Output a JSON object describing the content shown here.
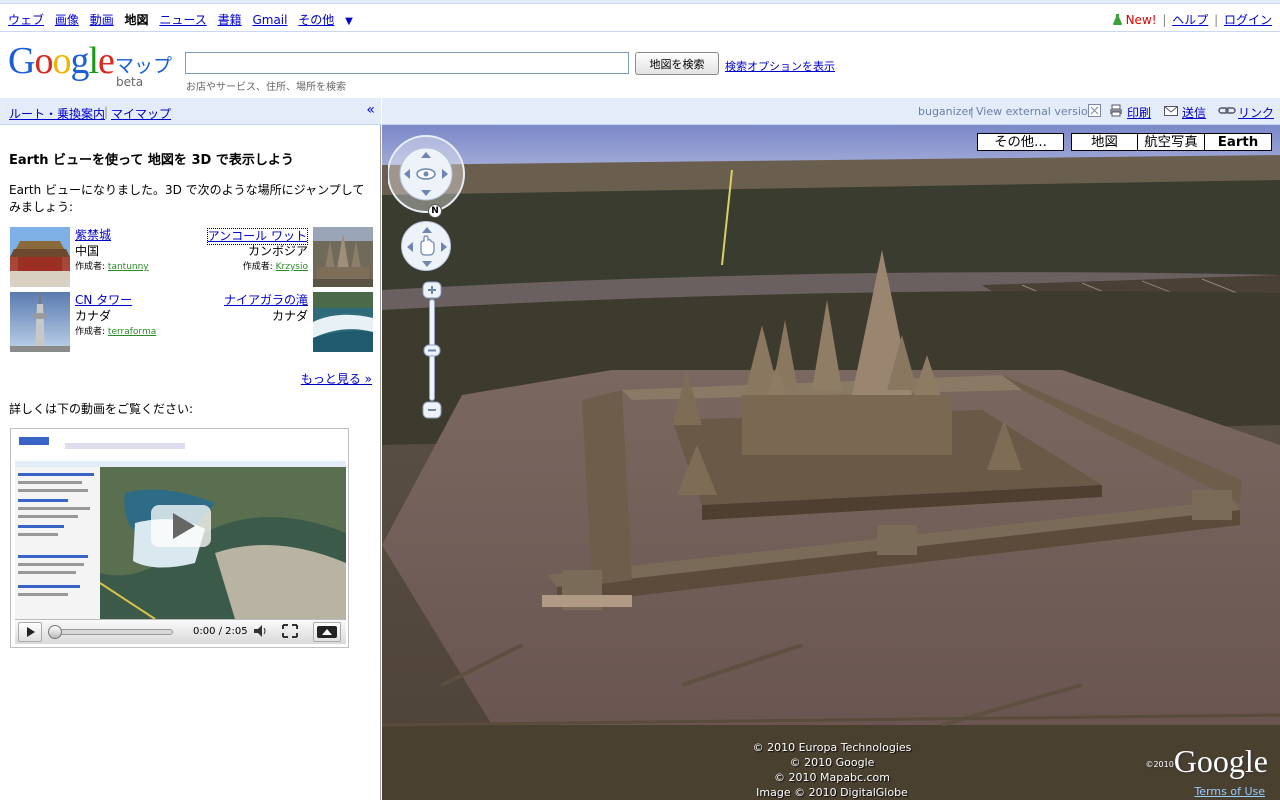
{
  "topnav": {
    "left_links": [
      "ウェブ",
      "画像",
      "動画",
      "地図",
      "ニュース",
      "書籍",
      "Gmail",
      "その他"
    ],
    "current": "地図",
    "more_arrow": "▼",
    "new_label": "New!",
    "sep": "|",
    "help": "ヘルプ",
    "login": "ログイン"
  },
  "header": {
    "logo_letters": [
      "G",
      "o",
      "o",
      "g",
      "l",
      "e"
    ],
    "maps_label": "マップ",
    "beta_label": "beta",
    "search_value": "",
    "search_hint": "お店やサービス、住所、場所を検索",
    "search_button": "地図を検索",
    "search_options": "検索オプションを表示"
  },
  "panel": {
    "route_link": "ルート・乗換案内",
    "sep": "|",
    "mymaps_link": "マイマップ",
    "collapse": "«",
    "title": "Earth ビューを使って 地図を 3D で表示しよう",
    "intro": "Earth ビューになりました。3D で次のような場所にジャンプしてみましょう:",
    "places": [
      {
        "name": "紫禁城",
        "country": "中国",
        "author_label": "作成者:",
        "author": "tantunny"
      },
      {
        "name": "アンコール ワット",
        "country": "カンボジア",
        "author_label": "作成者:",
        "author": "Krzysio"
      },
      {
        "name": "CN タワー",
        "country": "カナダ",
        "author_label": "作成者:",
        "author": "terraforma"
      },
      {
        "name": "ナイアガラの滝",
        "country": "カナダ",
        "author_label": "",
        "author": ""
      }
    ],
    "more_link": "もっと見る »",
    "video_caption": "詳しくは下の動画をご覧ください:",
    "video_time": "0:00 / 2:05"
  },
  "map": {
    "bar": {
      "buganizer": "buganizer",
      "sep": "|",
      "external": "View external version",
      "print": "印刷",
      "send": "送信",
      "link": "リンク"
    },
    "types": [
      "その他...",
      "地図",
      "航空写真",
      "Earth"
    ],
    "active_type": "Earth",
    "copyright": [
      "© 2010 Europa Technologies",
      "© 2010 Google",
      "© 2010 Mapabc.com",
      "Image © 2010 DigitalGlobe"
    ],
    "logo_small": "©2010",
    "logo": "Google",
    "terms": "Terms of Use",
    "compass_letter": "N"
  },
  "colors": {
    "link": "#0000cc",
    "bar_bg": "#e5ecf9",
    "new": "#dd0000",
    "author": "#2a8a2a"
  }
}
